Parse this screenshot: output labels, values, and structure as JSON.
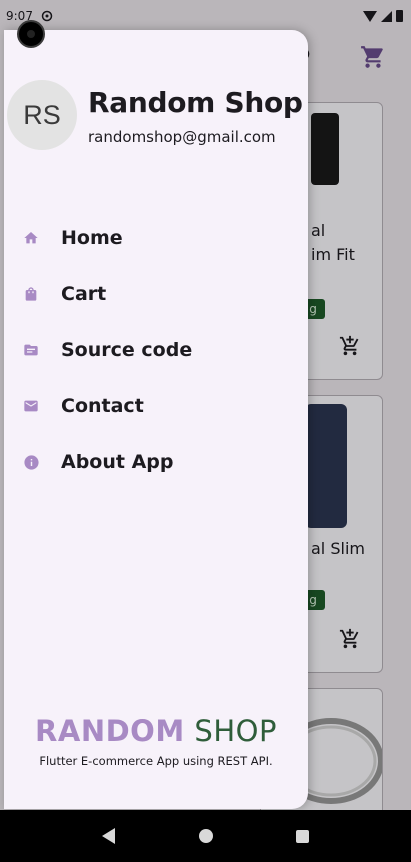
{
  "status_bar": {
    "time": "9:07"
  },
  "drawer": {
    "avatar_initials": "RS",
    "name": "Random Shop",
    "email": "randomshop@gmail.com",
    "menu": [
      {
        "label": "Home",
        "icon": "home-icon"
      },
      {
        "label": "Cart",
        "icon": "shopping-bag-icon"
      },
      {
        "label": "Source code",
        "icon": "folder-icon"
      },
      {
        "label": "Contact",
        "icon": "mail-icon"
      },
      {
        "label": "About App",
        "icon": "info-icon"
      }
    ],
    "brand_part1": "RANDOM",
    "brand_part2": " SHOP",
    "tagline": "Flutter E-commerce App using REST API."
  },
  "background": {
    "card1_line1": "al",
    "card1_line2": "im Fit",
    "card2_line1": "al Slim"
  },
  "colors": {
    "accent": "#a88ac4",
    "brand_green": "#2f5d3a",
    "drawer_bg": "#f7f2fa"
  }
}
